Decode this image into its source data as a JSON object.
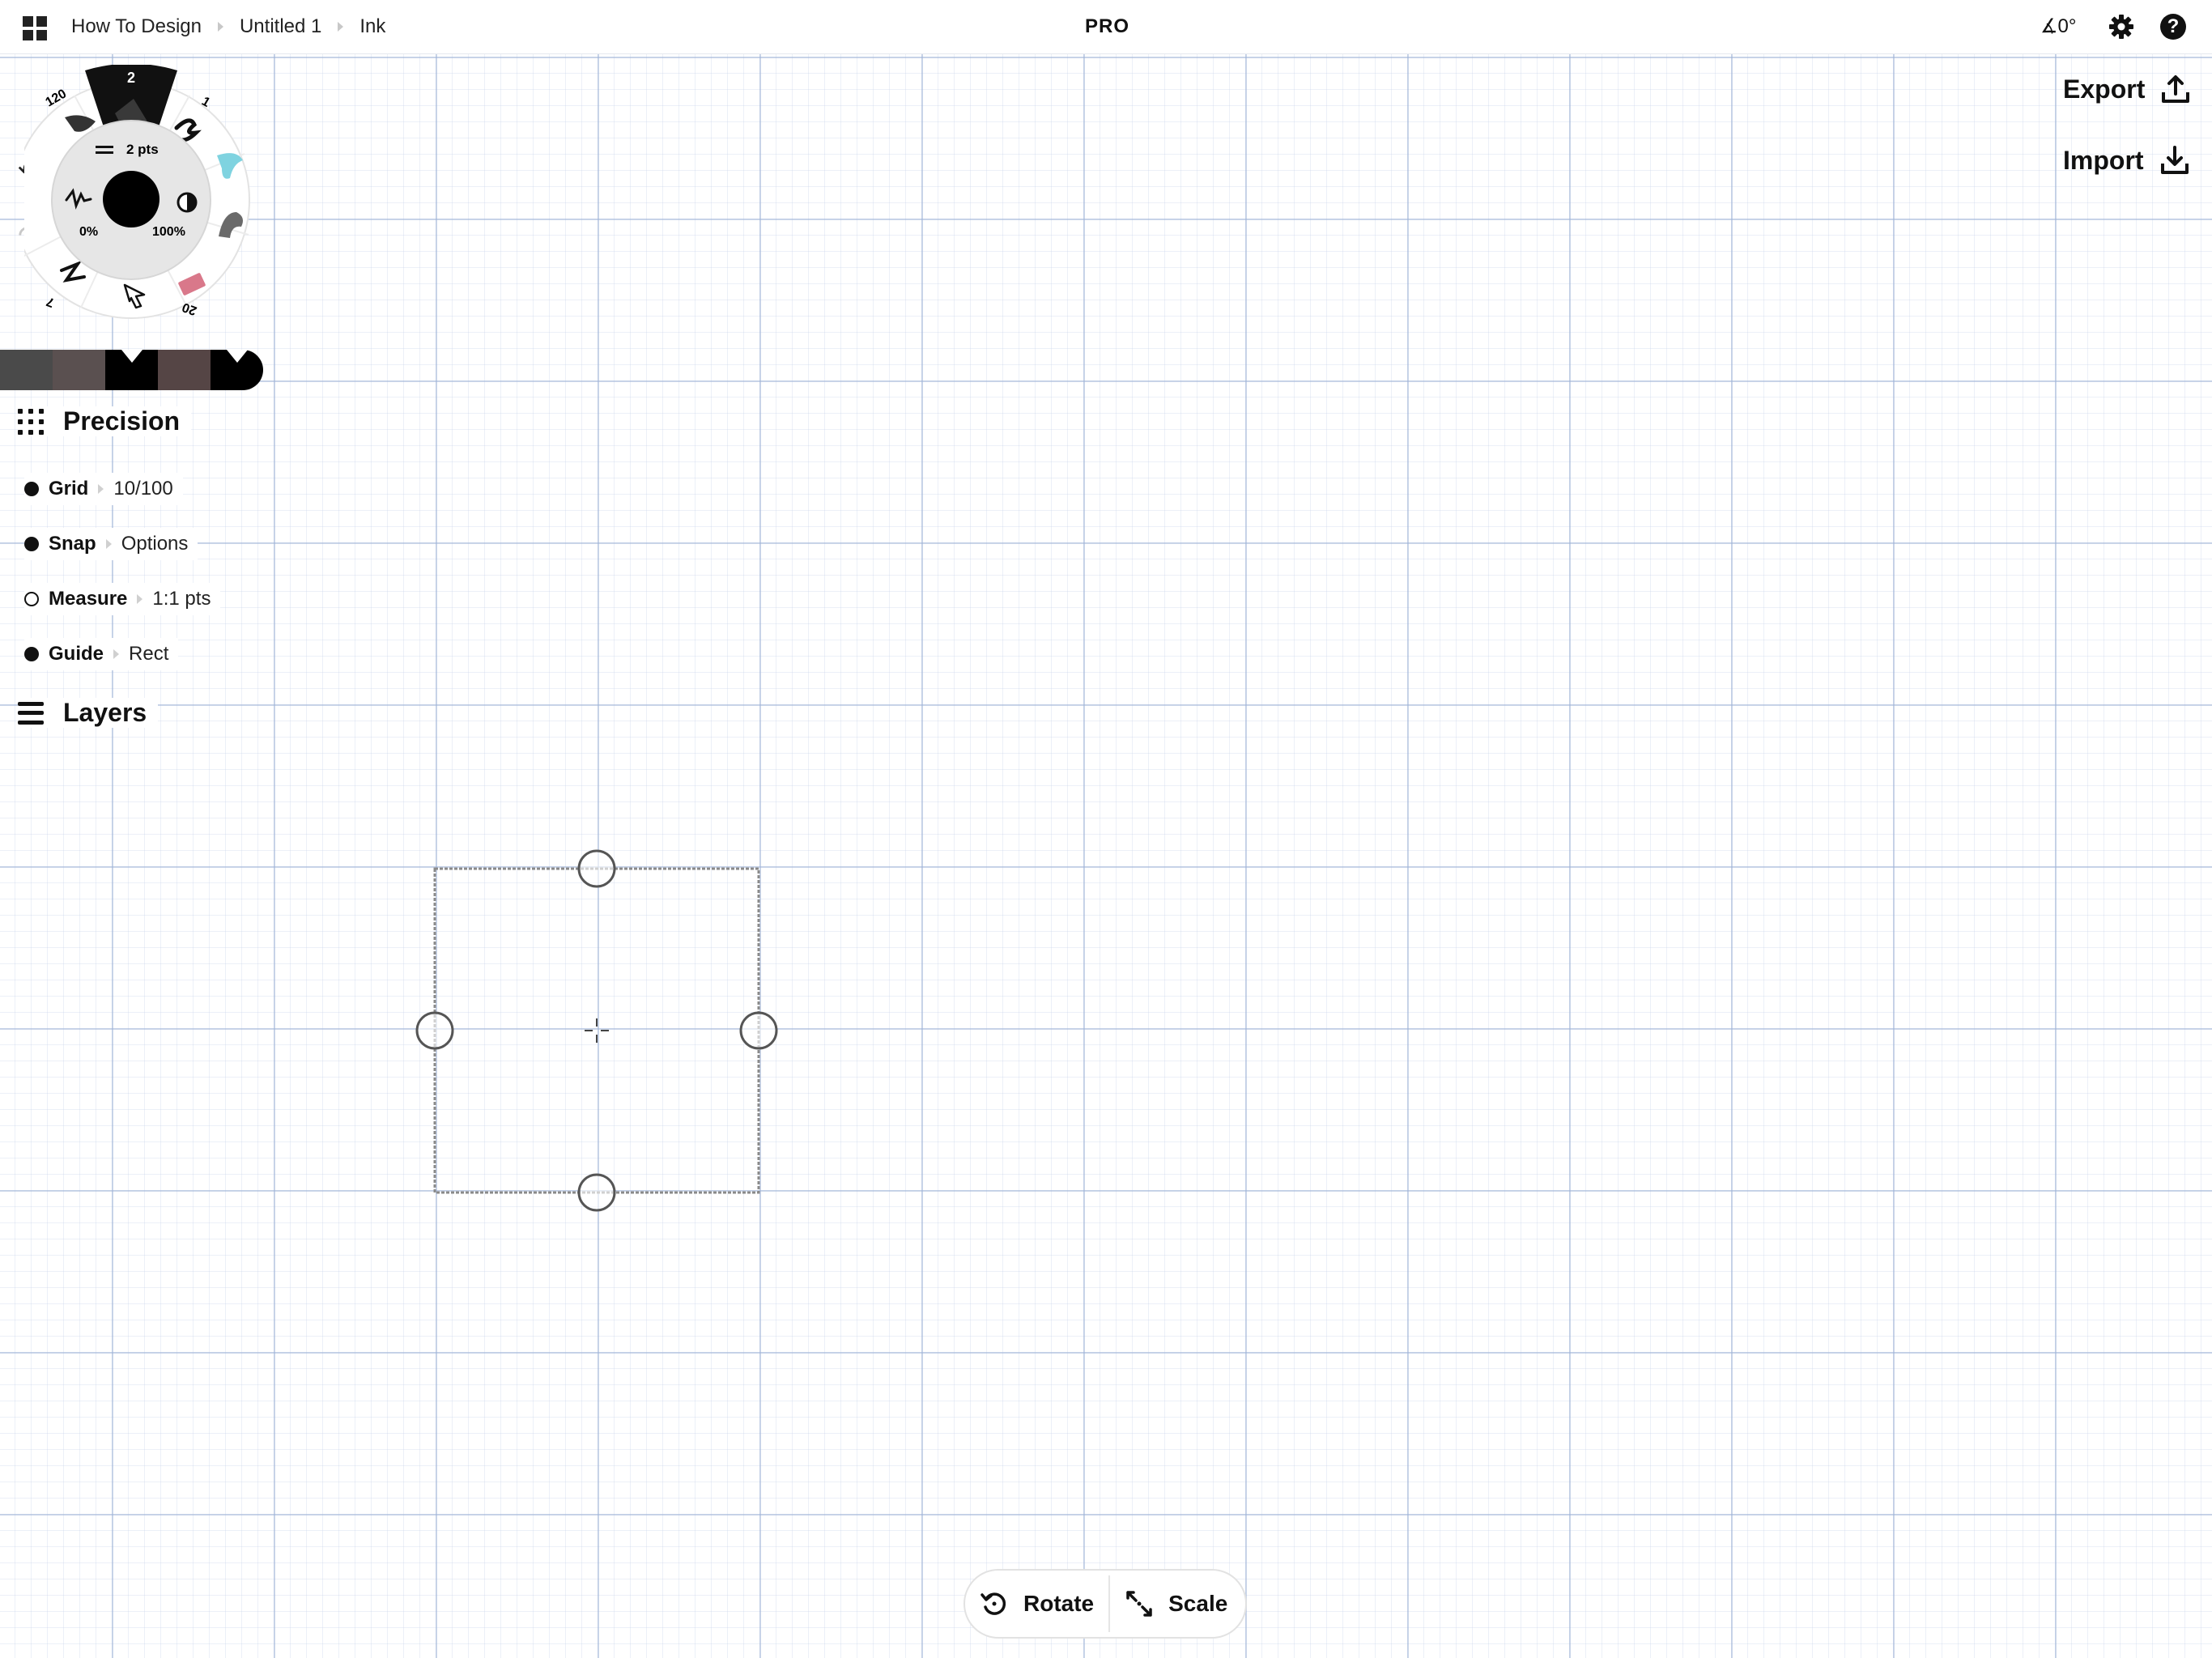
{
  "topbar": {
    "breadcrumbs": [
      "How To Design",
      "Untitled 1",
      "Ink"
    ],
    "badge": "PRO",
    "angle": "∡0°"
  },
  "actions": {
    "export_label": "Export",
    "import_label": "Import"
  },
  "tool_wheel": {
    "active_tool_size": "2",
    "sizes": [
      "120",
      "1",
      "7",
      "20"
    ],
    "stroke_width": "2 pts",
    "smoothing": "0%",
    "opacity": "100%",
    "current_color": "#000000",
    "tool_colors": [
      "#7fd3e0",
      "#6a6a6a",
      "#d9788a"
    ]
  },
  "color_strip": [
    "#4a4a4a",
    "#5a5050",
    "#000000",
    "#554545",
    "#000000"
  ],
  "precision": {
    "title": "Precision",
    "rows": [
      {
        "label": "Grid",
        "value": "10/100",
        "on": true
      },
      {
        "label": "Snap",
        "value": "Options",
        "on": true
      },
      {
        "label": "Measure",
        "value": "1:1 pts",
        "on": false
      },
      {
        "label": "Guide",
        "value": "Rect",
        "on": true
      }
    ]
  },
  "layers": {
    "title": "Layers"
  },
  "bottom_bar": {
    "rotate_label": "Rotate",
    "scale_label": "Scale"
  }
}
